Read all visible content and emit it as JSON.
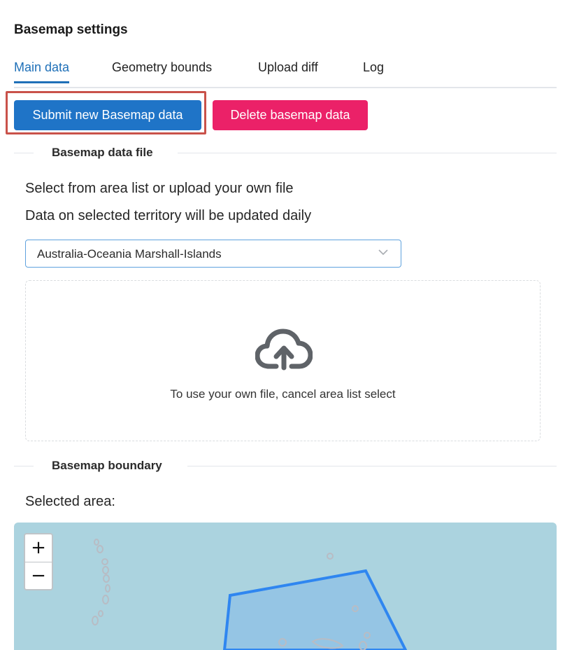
{
  "page": {
    "title": "Basemap settings"
  },
  "tabs": [
    {
      "label": "Main data",
      "active": true
    },
    {
      "label": "Geometry bounds",
      "active": false
    },
    {
      "label": "Upload diff",
      "active": false
    },
    {
      "label": "Log",
      "active": false
    }
  ],
  "actions": {
    "submit_label": "Submit new Basemap data",
    "delete_label": "Delete basemap data"
  },
  "data_file": {
    "section_title": "Basemap data file",
    "instruction": "Select from area list or upload your own file",
    "update_note": "Data on selected territory will be updated daily",
    "area_select": {
      "value": "Australia-Oceania Marshall-Islands"
    },
    "dropzone_text": "To use your own file, cancel area list select"
  },
  "boundary": {
    "section_title": "Basemap boundary",
    "selected_area_label": "Selected area:",
    "zoom_in_label": "+",
    "zoom_out_label": "−"
  },
  "colors": {
    "accent": "#1f74c7",
    "danger": "#eb2168",
    "map_water": "#abd3df",
    "boundary_stroke": "#2f86f0"
  },
  "icons": {
    "upload": "cloud-upload-icon",
    "dropdown": "chevron-down-icon"
  }
}
